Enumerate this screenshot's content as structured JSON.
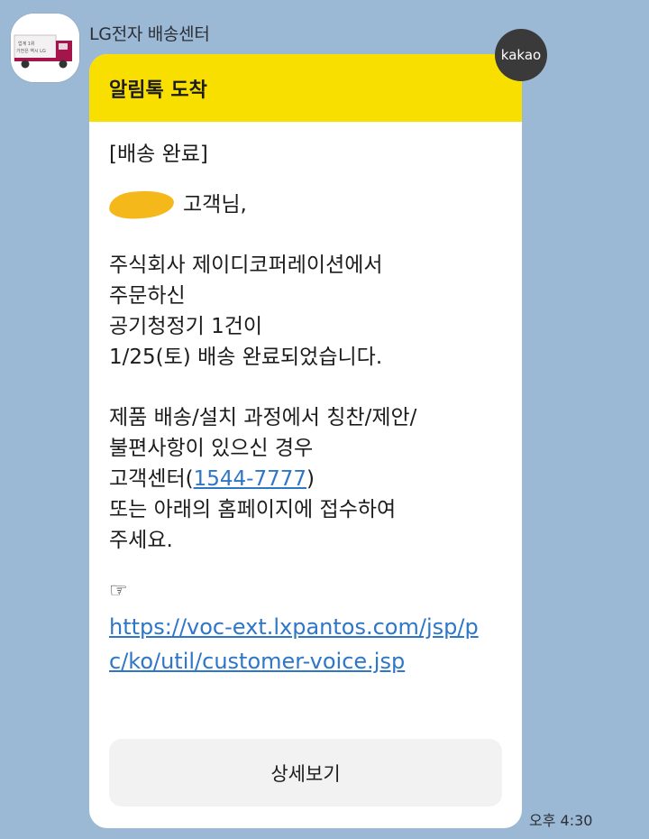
{
  "chat": {
    "sender_name": "LG전자 배송센터",
    "avatar_text": [
      "업계 1위",
      "가전은 역시 LG"
    ],
    "kakao_badge": "kakao",
    "header_title": "알림톡 도착",
    "status_tag": "[배송 완료]",
    "greeting": "고객님,",
    "lines_block1": [
      "주식회사 제이디코퍼레이션에서",
      "주문하신",
      "공기청정기 1건이",
      "1/25(토) 배송 완료되었습니다."
    ],
    "lines_block2": [
      "제품 배송/설치 과정에서 칭찬/제안/",
      "불편사항이 있으신 경우"
    ],
    "contact_prefix": "고객센터(",
    "phone": "1544-7777",
    "contact_suffix": ")",
    "lines_block3": [
      "또는 아래의 홈페이지에 접수하여",
      "주세요."
    ],
    "pointer_icon": "☞",
    "url": "https://voc-ext.lxpantos.com/jsp/pc/ko/util/customer-voice.jsp",
    "detail_button": "상세보기",
    "time": "오후 4:30"
  },
  "colors": {
    "background": "#9bb8d4",
    "header": "#f9df00",
    "link": "#2e76c8",
    "badge": "#3a3a3a"
  }
}
